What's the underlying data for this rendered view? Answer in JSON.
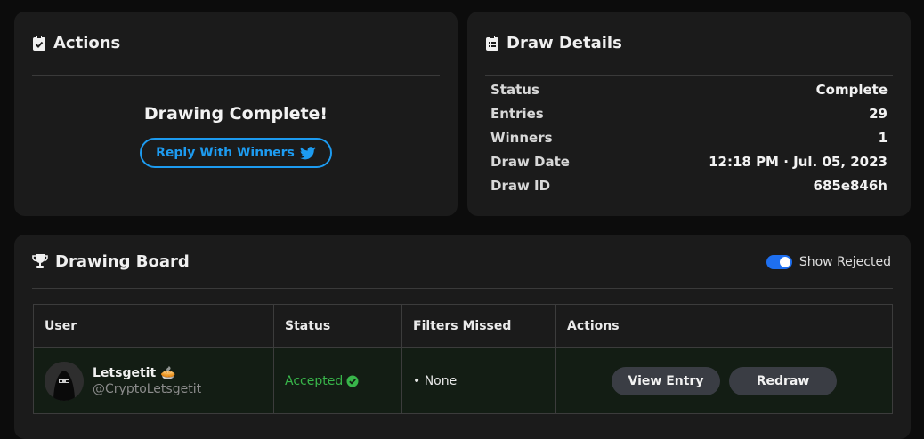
{
  "actions": {
    "title": "Actions",
    "complete_text": "Drawing Complete!",
    "reply_button": "Reply With Winners"
  },
  "details": {
    "title": "Draw Details",
    "rows": [
      {
        "label": "Status",
        "value": "Complete"
      },
      {
        "label": "Entries",
        "value": "29"
      },
      {
        "label": "Winners",
        "value": "1"
      },
      {
        "label": "Draw Date",
        "value": "12:18 PM · Jul. 05, 2023"
      },
      {
        "label": "Draw ID",
        "value": "685e846h"
      }
    ]
  },
  "board": {
    "title": "Drawing Board",
    "toggle_label": "Show Rejected",
    "toggle_on": true,
    "columns": [
      "User",
      "Status",
      "Filters Missed",
      "Actions"
    ],
    "rows": [
      {
        "name": "Letsgetit",
        "name_emoji": "🥧",
        "handle": "@CryptoLetsgetit",
        "status": "Accepted",
        "filters": "• None",
        "view_button": "View Entry",
        "redraw_button": "Redraw"
      }
    ]
  },
  "colors": {
    "accent_blue": "#1d9bf0",
    "accepted_green": "#38b54a",
    "toggle_blue": "#1e6ff0"
  },
  "icons": [
    "clipboard-check-icon",
    "clipboard-list-icon",
    "trophy-icon",
    "twitter-icon",
    "check-circle-icon"
  ]
}
